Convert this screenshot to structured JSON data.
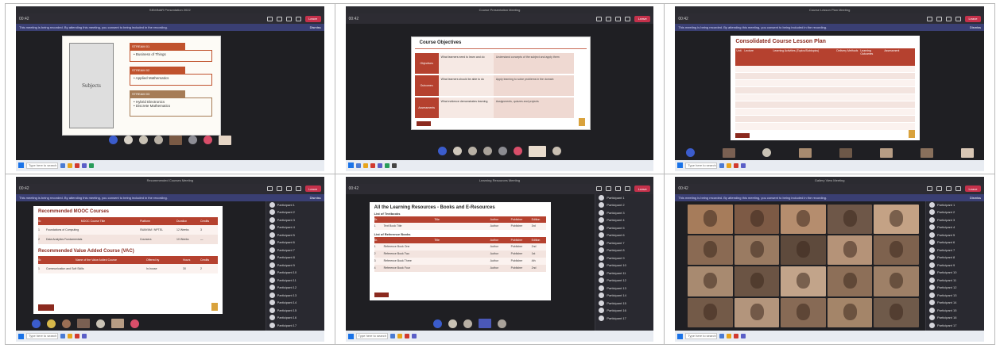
{
  "panels": [
    {
      "window_title": "SEMINAR Presentation 2022",
      "time": "00:42",
      "leave_label": "Leave",
      "banner": "This meeting is being recorded. By attending this meeting, you consent to being included in the recording.",
      "dismiss": "Dismiss",
      "search": "Type here to search",
      "slide": {
        "subjects_label": "Subjects",
        "items": [
          {
            "head": "STREAM 01",
            "body": "• Business of Things"
          },
          {
            "head": "STREAM 02",
            "body": "• Applied Mathematics"
          },
          {
            "head": "STREAM 03",
            "body": "• Hybrid Electronics\n• Discrete Mathematics"
          }
        ]
      }
    },
    {
      "window_title": "Course Presentation Meeting",
      "time": "00:42",
      "leave_label": "Leave",
      "search": "Type here to search",
      "slide": {
        "title": "Course Objectives",
        "rows": [
          {
            "label": "Objectives",
            "left": "What learners need to learn and do",
            "right": "Understand concepts of the subject and apply them"
          },
          {
            "label": "Outcomes",
            "left": "What learners should be able to do",
            "right": "Apply learning to solve problems in the domain"
          },
          {
            "label": "Assessments",
            "left": "What evidence demonstrates learning",
            "right": "Assignments, quizzes and projects"
          }
        ]
      }
    },
    {
      "window_title": "Course Lesson Plan Meeting",
      "time": "00:42",
      "leave_label": "Leave",
      "banner": "This meeting is being recorded. By attending this meeting, you consent to being included in the recording.",
      "dismiss": "Dismiss",
      "search": "Type here to search",
      "slide": {
        "title": "Consolidated Course Lesson Plan",
        "headers": [
          "Unit",
          "Lecture",
          "Learning Activities (Topics/Subtopics)",
          "Delivery Methods",
          "Learning Outcomes",
          "Assessment"
        ],
        "row_count": 9
      }
    },
    {
      "window_title": "Recommended Courses Meeting",
      "time": "00:42",
      "leave_label": "Leave",
      "banner": "This meeting is being recorded. By attending this meeting, you consent to being included in the recording.",
      "dismiss": "Dismiss",
      "search": "Type here to search",
      "slide": {
        "title1": "Recommended MOOC Courses",
        "headers1": [
          "Sr.",
          "MOOC Course Title",
          "Platform",
          "Duration",
          "Credits"
        ],
        "rows1": [
          {
            "a": "1",
            "b": "Foundations of Computing",
            "c": "SWAYAM / NPTEL",
            "d": "12 Weeks",
            "e": "3"
          },
          {
            "a": "2",
            "b": "Data Analytics Fundamentals",
            "c": "Coursera",
            "d": "10 Weeks",
            "e": "—"
          }
        ],
        "title2": "Recommended Value Added Course (VAC)",
        "headers2": [
          "Sr.",
          "Name of the Value Added Course",
          "Offered by",
          "Hours",
          "Credits"
        ],
        "rows2": [
          {
            "a": "1",
            "b": "Communication and Soft Skills",
            "c": "In-house",
            "d": "30",
            "e": "2"
          }
        ]
      },
      "participants": [
        "Participant 1",
        "Participant 2",
        "Participant 3",
        "Participant 4",
        "Participant 5",
        "Participant 6",
        "Participant 7",
        "Participant 8",
        "Participant 9",
        "Participant 10",
        "Participant 11",
        "Participant 12",
        "Participant 13",
        "Participant 14",
        "Participant 15",
        "Participant 16",
        "Participant 17"
      ]
    },
    {
      "window_title": "Learning Resources Meeting",
      "time": "00:42",
      "leave_label": "Leave",
      "search": "Type here to search",
      "slide": {
        "title": "All the Learning Resources - Books and E-Resources",
        "sub1": "List of Textbooks",
        "sub2": "List of Reference Books",
        "headers": [
          "Sr.",
          "Title",
          "Author",
          "Publisher",
          "Edition"
        ],
        "rows": [
          {
            "a": "1",
            "b": "Text Book Title",
            "c": "Author",
            "d": "Publisher",
            "e": "3rd"
          },
          {
            "a": "1",
            "b": "Reference Book One",
            "c": "Author",
            "d": "Publisher",
            "e": "2nd"
          },
          {
            "a": "2",
            "b": "Reference Book Two",
            "c": "Author",
            "d": "Publisher",
            "e": "1st"
          },
          {
            "a": "3",
            "b": "Reference Book Three",
            "c": "Author",
            "d": "Publisher",
            "e": "4th"
          },
          {
            "a": "4",
            "b": "Reference Book Four",
            "c": "Author",
            "d": "Publisher",
            "e": "2nd"
          }
        ]
      },
      "participants": [
        "Participant 1",
        "Participant 2",
        "Participant 3",
        "Participant 4",
        "Participant 5",
        "Participant 6",
        "Participant 7",
        "Participant 8",
        "Participant 9",
        "Participant 10",
        "Participant 11",
        "Participant 12",
        "Participant 13",
        "Participant 14",
        "Participant 15",
        "Participant 16",
        "Participant 17"
      ]
    },
    {
      "window_title": "Gallery View Meeting",
      "time": "00:42",
      "leave_label": "Leave",
      "banner": "This meeting is being recorded. By attending this meeting, you consent to being included in the recording.",
      "dismiss": "Dismiss",
      "search": "Type here to search",
      "participants": [
        "Participant 1",
        "Participant 2",
        "Participant 3",
        "Participant 4",
        "Participant 5",
        "Participant 6",
        "Participant 7",
        "Participant 8",
        "Participant 9",
        "Participant 10",
        "Participant 11",
        "Participant 12",
        "Participant 13",
        "Participant 14",
        "Participant 15",
        "Participant 16",
        "Participant 17"
      ],
      "video_colors": [
        "#a67c5b",
        "#7d5a45",
        "#b58d6e",
        "#6e5748",
        "#c4a285",
        "#8a6a53",
        "#9a7b62",
        "#5e4a3c",
        "#b59378",
        "#7e624e",
        "#a88a70",
        "#6b5444",
        "#c2a48a",
        "#8d6f58",
        "#9e8067",
        "#735a48",
        "#b3957c",
        "#876a55",
        "#a48569",
        "#6f5a4a"
      ]
    }
  ]
}
